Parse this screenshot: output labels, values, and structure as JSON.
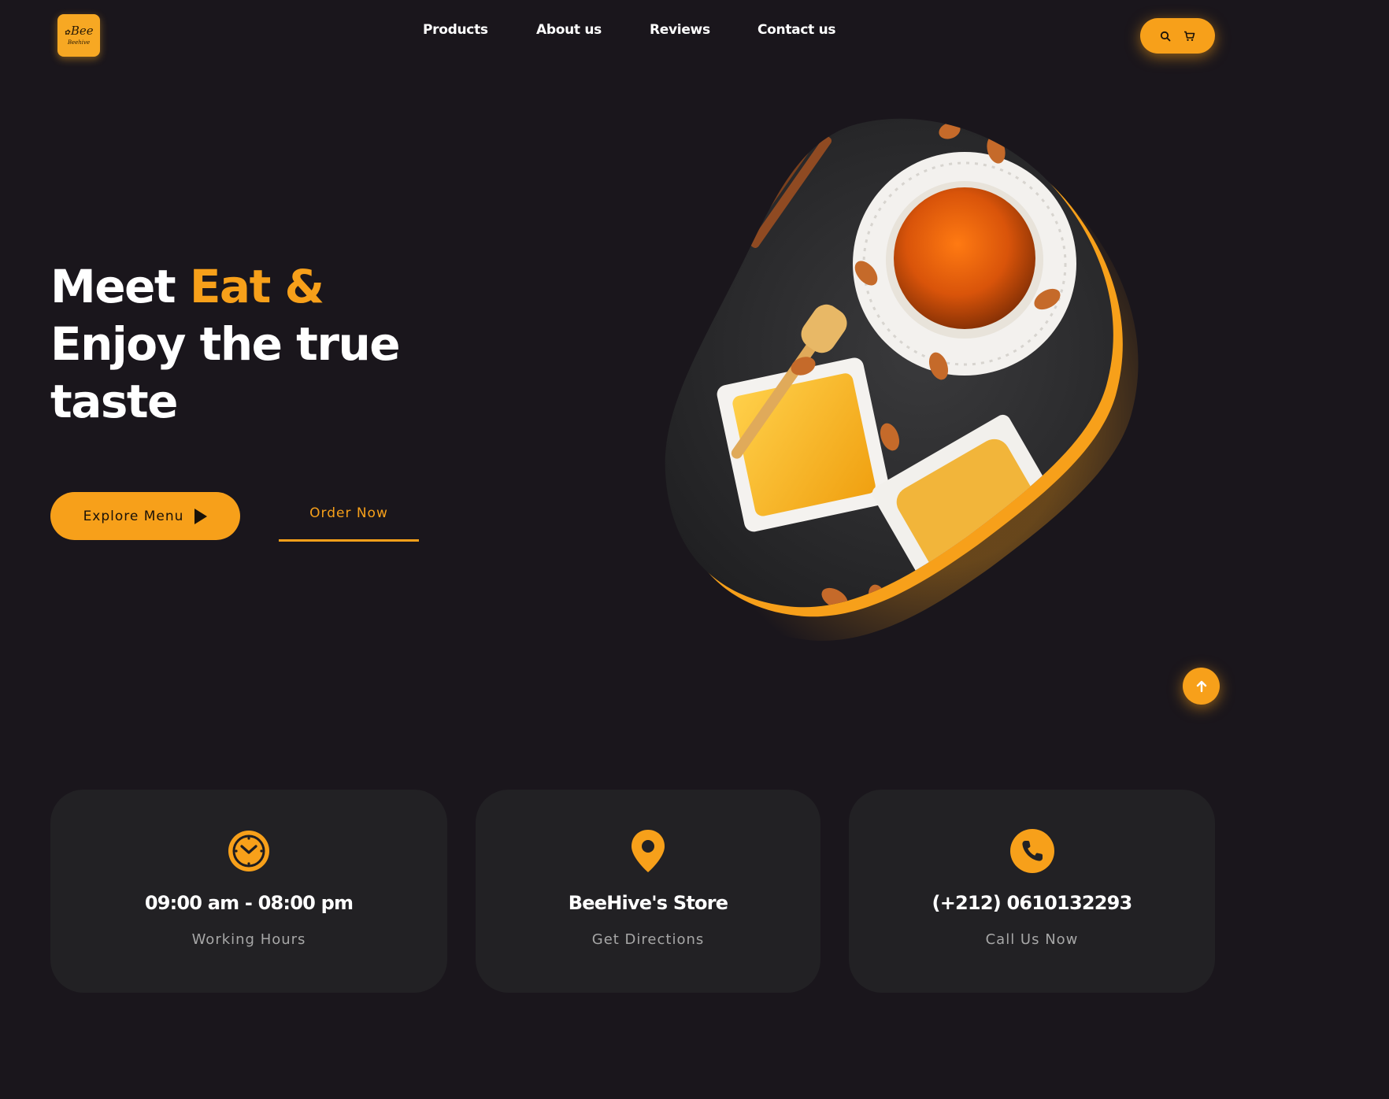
{
  "brand": {
    "logo_text": "Bee",
    "logo_subtext": "Beehive"
  },
  "nav": {
    "items": [
      {
        "label": "Products"
      },
      {
        "label": "About us"
      },
      {
        "label": "Reviews"
      },
      {
        "label": "Contact us"
      }
    ]
  },
  "header_actions": {
    "search_icon": "search-icon",
    "cart_icon": "cart-icon"
  },
  "hero": {
    "title_line1_plain": "Meet ",
    "title_line1_accent": "Eat &",
    "title_line2": "Enjoy the true",
    "title_line3": "taste",
    "explore_button": "Explore Menu",
    "order_button": "Order Now",
    "image_icon": "honey-food-photo"
  },
  "scroll_top": {
    "icon": "arrow-up-icon"
  },
  "info_cards": [
    {
      "icon": "clock-icon",
      "title": "09:00 am - 08:00 pm",
      "subtitle": "Working Hours"
    },
    {
      "icon": "location-pin-icon",
      "title": "BeeHive's Store",
      "subtitle": "Get Directions"
    },
    {
      "icon": "phone-icon",
      "title": "(+212) 0610132293",
      "subtitle": "Call Us Now"
    }
  ],
  "colors": {
    "background": "#1a161c",
    "accent": "#f7a01a",
    "card": "#222124",
    "muted_text": "#a7a7a7"
  }
}
